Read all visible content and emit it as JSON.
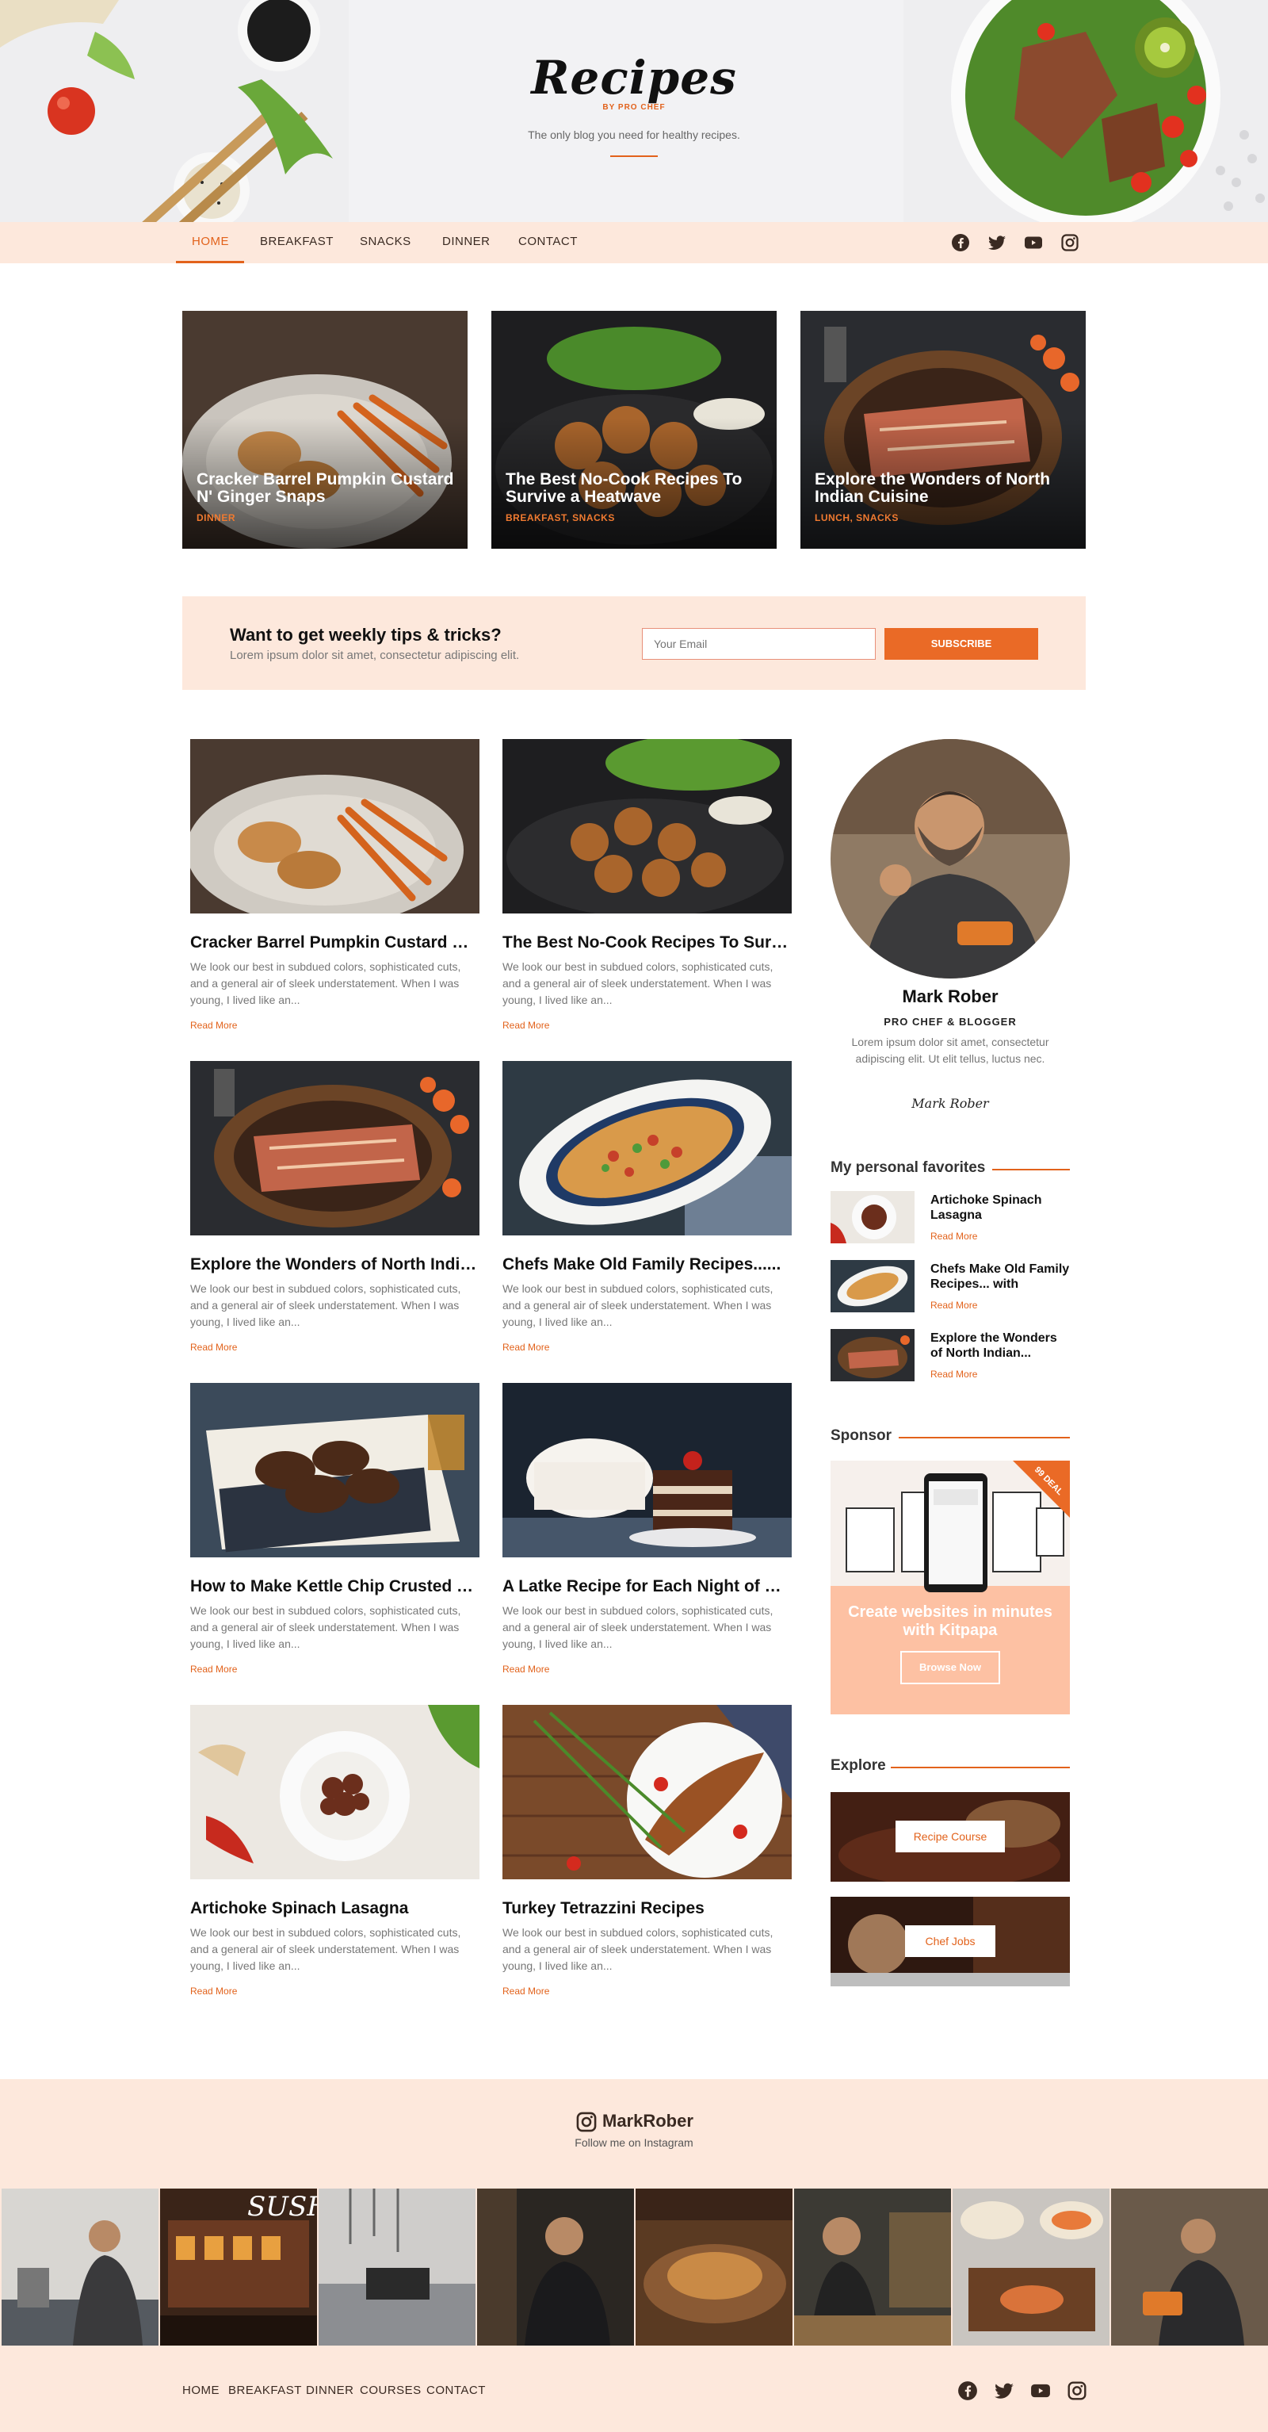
{
  "header": {
    "logo_title": "Recipes",
    "logo_sub": "BY PRO CHEF",
    "tagline": "The only blog you need for healthy recipes."
  },
  "nav": {
    "items": [
      "HOME",
      "BREAKFAST",
      "SNACKS",
      "DINNER",
      "CONTACT"
    ],
    "active": "HOME",
    "social_icons": [
      "facebook-icon",
      "twitter-icon",
      "youtube-icon",
      "instagram-icon"
    ]
  },
  "featured": [
    {
      "title": "Cracker Barrel Pumpkin Custard N' Ginger Snaps",
      "category": "DINNER"
    },
    {
      "title": "The Best No-Cook Recipes To Survive a Heatwave",
      "category": "BREAKFAST, SNACKS"
    },
    {
      "title": "Explore the Wonders of North Indian Cuisine",
      "category": "LUNCH, SNACKS"
    }
  ],
  "newsletter": {
    "title": "Want to get weekly tips & tricks?",
    "subtitle": "Lorem ipsum dolor sit amet, consectetur adipiscing elit.",
    "email_placeholder": "Your Email",
    "button": "SUBSCRIBE"
  },
  "posts": [
    {
      "title": "Cracker Barrel Pumpkin Custard N' Ginger Snaps",
      "excerpt": "We look our best in subdued colors, sophisticated cuts, and a general air of sleek understatement. When I was young, I lived like an...",
      "more": "Read More"
    },
    {
      "title": "The Best No-Cook Recipes To Survive a Heatwave",
      "excerpt": "We look our best in subdued colors, sophisticated cuts, and a general air of sleek understatement. When I was young, I lived like an...",
      "more": "Read More"
    },
    {
      "title": "Explore the Wonders of North Indian Cuisine",
      "excerpt": "We look our best in subdued colors, sophisticated cuts, and a general air of sleek understatement. When I was young, I lived like an...",
      "more": "Read More"
    },
    {
      "title": "Chefs Make Old Family Recipes......",
      "excerpt": "We look our best in subdued colors, sophisticated cuts, and a general air of sleek understatement. When I was young, I lived like an...",
      "more": "Read More"
    },
    {
      "title": "How to Make Kettle Chip Crusted Chicken",
      "excerpt": "We look our best in subdued colors, sophisticated cuts, and a general air of sleek understatement. When I was young, I lived like an...",
      "more": "Read More"
    },
    {
      "title": "A Latke Recipe for Each Night of Hanukkah",
      "excerpt": "We look our best in subdued colors, sophisticated cuts, and a general air of sleek understatement. When I was young, I lived like an...",
      "more": "Read More"
    },
    {
      "title": "Artichoke Spinach Lasagna",
      "excerpt": "We look our best in subdued colors, sophisticated cuts, and a general air of sleek understatement. When I was young, I lived like an...",
      "more": "Read More"
    },
    {
      "title": "Turkey Tetrazzini Recipes",
      "excerpt": "We look our best in subdued colors, sophisticated cuts, and a general air of sleek understatement. When I was young, I lived like an...",
      "more": "Read More"
    }
  ],
  "author": {
    "name": "Mark Rober",
    "role": "PRO CHEF & BLOGGER",
    "bio": "Lorem ipsum dolor sit amet, consectetur adipiscing elit. Ut elit tellus, luctus nec.",
    "signature": "Mark Rober"
  },
  "favorites": {
    "heading": "My personal favorites",
    "items": [
      {
        "title": "Artichoke Spinach Lasagna",
        "more": "Read More"
      },
      {
        "title": "Chefs Make Old Family Recipes... with",
        "more": "Read More"
      },
      {
        "title": "Explore the Wonders of North Indian...",
        "more": "Read More"
      }
    ]
  },
  "sponsor": {
    "heading": "Sponsor",
    "text": "Create websites in minutes with Kitpapa",
    "button": "Browse Now",
    "ribbon": "99 DEAL"
  },
  "explore": {
    "heading": "Explore",
    "cards": [
      "Recipe Course",
      "Chef Jobs"
    ]
  },
  "footer": {
    "ig_handle": "MarkRober",
    "ig_sub": "Follow me on Instagram",
    "links": [
      "HOME",
      "BREAKFAST",
      "DINNER",
      "COURSES",
      "CONTACT"
    ],
    "social_icons": [
      "facebook-icon",
      "twitter-icon",
      "youtube-icon",
      "instagram-icon"
    ]
  },
  "colors": {
    "accent": "#e2621b",
    "peach": "#fde8dc",
    "sponsor_bg": "#fdc1a3"
  }
}
